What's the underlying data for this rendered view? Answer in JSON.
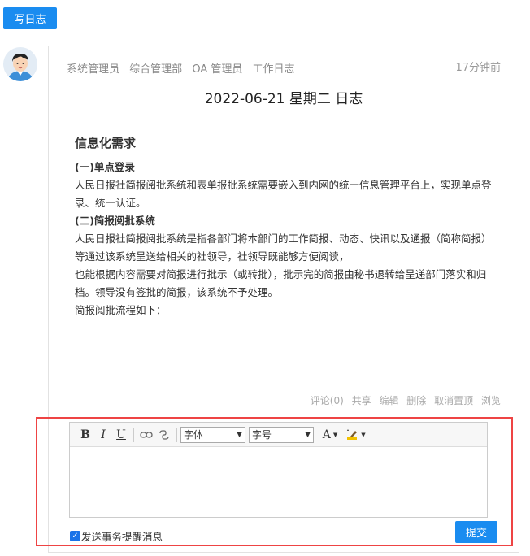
{
  "header": {
    "write_button": "写日志"
  },
  "post": {
    "author": "系统管理员",
    "department": "综合管理部",
    "group": "OA 管理员",
    "category": "工作日志",
    "time": "17分钟前",
    "title": "2022-06-21 星期二 日志",
    "content": {
      "heading": "信息化需求",
      "s1_title": "(一)单点登录",
      "s1_p": "人民日报社简报阅批系统和表单报批系统需要嵌入到内网的统一信息管理平台上，实现单点登录、统一认证。",
      "s2_title": "(二)简报阅批系统",
      "s2_p1": "人民日报社简报阅批系统是指各部门将本部门的工作简报、动态、快讯以及通报（简称简报）等通过该系统呈送给相关的社领导，社领导既能够方便阅读，",
      "s2_p2": "也能根据内容需要对简报进行批示（或转批），批示完的简报由秘书退转给呈递部门落实和归档。领导没有签批的简报，该系统不予处理。",
      "s2_p3": "简报阅批流程如下："
    },
    "actions": {
      "comment": "评论(0)",
      "share": "共享",
      "edit": "编辑",
      "delete": "删除",
      "unpin": "取消置顶",
      "view": "浏览"
    }
  },
  "editor": {
    "bold": "B",
    "italic": "I",
    "underline": "U",
    "font_select": "字体",
    "size_select": "字号",
    "font_color_glyph": "A",
    "notify_label": "发送事务提醒消息",
    "notify_checked": true,
    "submit_label": "提交"
  },
  "colors": {
    "primary": "#1a8cf0",
    "highlight_border": "#e44444"
  }
}
